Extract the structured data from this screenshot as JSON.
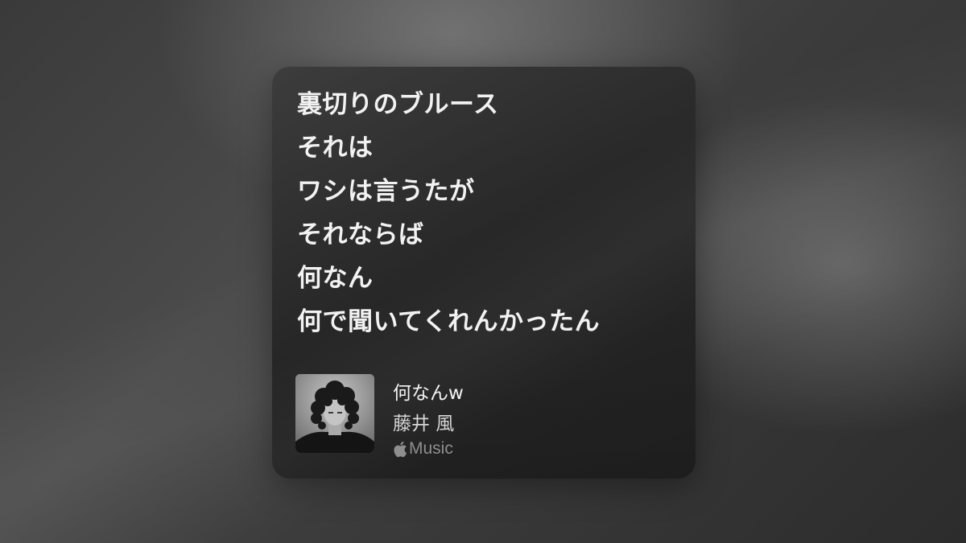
{
  "lyrics": {
    "lines": [
      "裏切りのブルース",
      "それは",
      "ワシは言うたが",
      "それならば",
      "何なん",
      "何で聞いてくれんかったん"
    ]
  },
  "track": {
    "title": "何なんw",
    "artist": "藤井 風",
    "artwork_icon": "album-artwork"
  },
  "service": {
    "icon": "apple-logo-icon",
    "label": "Music"
  },
  "colors": {
    "card_background": "#262626",
    "lyric_text": "#f2f2f2",
    "secondary_text": "#8e8e8e"
  }
}
